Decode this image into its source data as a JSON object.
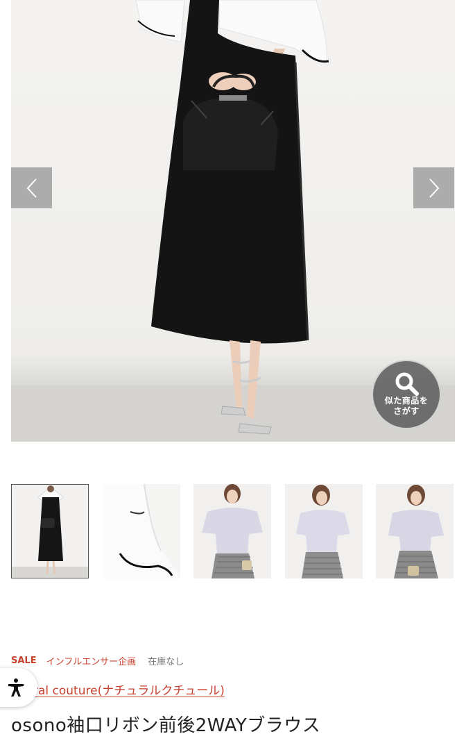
{
  "gallery": {
    "prev_icon": "chevron-left-icon",
    "next_icon": "chevron-right-icon",
    "similar_button": {
      "icon": "search-icon",
      "line1": "似た商品を",
      "line2": "さがす"
    },
    "thumbnail_count": 5,
    "active_thumbnail": 1
  },
  "product": {
    "tags": {
      "sale": "SALE",
      "influencer": "インフルエンサー企画",
      "stock": "在庫なし"
    },
    "brand": "ral couture(ナチュラルクチュール)",
    "title": "osono袖口リボン前後2WAYブラウス"
  },
  "accessibility_button": {
    "icon": "accessibility-icon"
  },
  "colors": {
    "accent": "#c8402e",
    "text": "#222222",
    "muted": "#777777",
    "arrow_bg": "#969696"
  }
}
